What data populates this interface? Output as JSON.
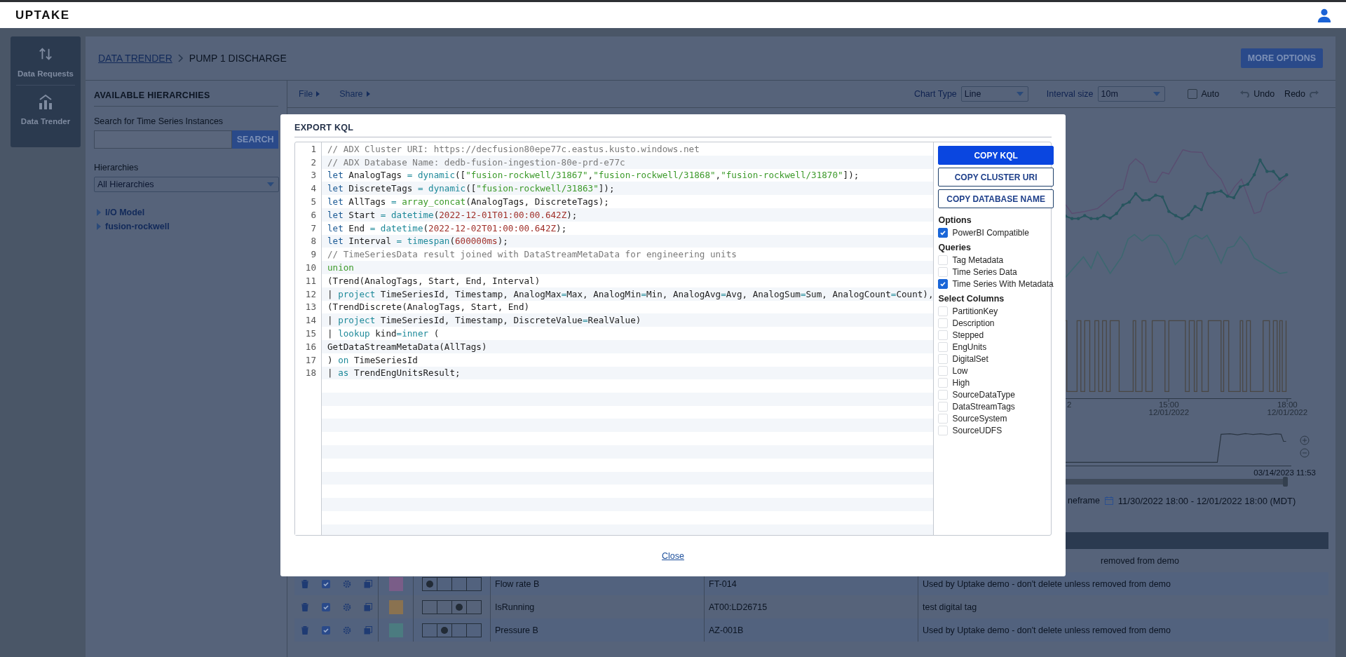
{
  "header": {
    "logo": "UPTAKE"
  },
  "nav": [
    {
      "label": "Data Requests",
      "kind": "requests"
    },
    {
      "label": "Data Trender",
      "kind": "trender"
    }
  ],
  "breadcrumb": {
    "link": "DATA TRENDER",
    "current": "PUMP 1 DISCHARGE"
  },
  "more_options": "MORE OPTIONS",
  "hierarchies_panel": {
    "title": "AVAILABLE HIERARCHIES",
    "search_label": "Search for Time Series Instances",
    "search_button": "SEARCH",
    "hierarchies_label": "Hierarchies",
    "hierarchies_value": "All Hierarchies",
    "tree": [
      {
        "label": "I/O Model",
        "expanded": false
      },
      {
        "label": "fusion-rockwell",
        "expanded": false
      }
    ]
  },
  "toolbar": {
    "menus": [
      "File",
      "Share"
    ],
    "chart_type_label": "Chart Type",
    "chart_type": "Line",
    "interval_label": "Interval size",
    "interval": "10m",
    "auto": {
      "label": "Auto",
      "checked": false
    },
    "undo": "Undo",
    "redo": "Redo"
  },
  "chart": {
    "x_labels": [
      {
        "lines": [
          "2"
        ]
      },
      {
        "lines": [
          "15:00",
          "12/01/2022"
        ]
      },
      {
        "lines": [
          "18:00",
          "12/01/2022"
        ]
      }
    ]
  },
  "overview": {
    "end_label": "03/14/2023 11:53",
    "timeframe_label": "neframe",
    "timeframe": "11/30/2022 18:00 - 12/01/2022 18:00 (MDT)"
  },
  "table": {
    "rows": [
      {
        "description": "removed from demo"
      },
      {
        "visible": true,
        "color": "#7a5d88",
        "positions": [
          {
            "selected": true
          },
          {
            "selected": false
          },
          {
            "selected": false
          },
          {
            "selected": false
          }
        ],
        "name": "Flow rate B",
        "tag": "FT-014",
        "description": "Used by Uptake demo - don't delete unless removed from demo"
      },
      {
        "visible": true,
        "color": "#8a7250",
        "positions": [
          {
            "selected": false
          },
          {
            "selected": false
          },
          {
            "selected": true
          },
          {
            "selected": false
          }
        ],
        "name": "IsRunning",
        "tag": "AT00:LD26715",
        "description": "test digital tag"
      },
      {
        "visible": true,
        "color": "#4b7b80",
        "positions": [
          {
            "selected": false
          },
          {
            "selected": true
          },
          {
            "selected": false
          },
          {
            "selected": false
          }
        ],
        "name": "Pressure B",
        "tag": "AZ-001B",
        "description": "Used by Uptake demo - don't delete unless removed from demo"
      }
    ]
  },
  "modal": {
    "title": "EXPORT KQL",
    "code": [
      {
        "number": "1",
        "tokens": [
          {
            "kind": "comment",
            "text": "// ADX Cluster URI: https://decfusion80epe77c.eastus.kusto.windows.net"
          }
        ]
      },
      {
        "number": "2",
        "tokens": [
          {
            "kind": "comment",
            "text": "// ADX Database Name: dedb-fusion-ingestion-80e-prd-e77c"
          }
        ]
      },
      {
        "number": "3",
        "tokens": [
          {
            "kind": "keyword",
            "text": "let"
          },
          {
            "kind": "plain",
            "text": " AnalogTags "
          },
          {
            "kind": "function",
            "text": "="
          },
          {
            "kind": "function",
            "text": " dynamic"
          },
          {
            "kind": "plain",
            "text": "(["
          },
          {
            "kind": "string",
            "text": "\"fusion-rockwell/31867\""
          },
          {
            "kind": "plain",
            "text": ","
          },
          {
            "kind": "string",
            "text": "\"fusion-rockwell/31868\""
          },
          {
            "kind": "plain",
            "text": ","
          },
          {
            "kind": "string",
            "text": "\"fusion-rockwell/31870\""
          },
          {
            "kind": "plain",
            "text": "]);"
          }
        ]
      },
      {
        "number": "4",
        "tokens": [
          {
            "kind": "keyword",
            "text": "let"
          },
          {
            "kind": "plain",
            "text": " DiscreteTags "
          },
          {
            "kind": "function",
            "text": "="
          },
          {
            "kind": "function",
            "text": " dynamic"
          },
          {
            "kind": "plain",
            "text": "(["
          },
          {
            "kind": "string",
            "text": "\"fusion-rockwell/31863\""
          },
          {
            "kind": "plain",
            "text": "]);"
          }
        ]
      },
      {
        "number": "5",
        "tokens": [
          {
            "kind": "keyword",
            "text": "let"
          },
          {
            "kind": "plain",
            "text": " AllTags "
          },
          {
            "kind": "function",
            "text": "="
          },
          {
            "kind": "builtin",
            "text": " array_concat"
          },
          {
            "kind": "plain",
            "text": "(AnalogTags, DiscreteTags);"
          }
        ]
      },
      {
        "number": "6",
        "tokens": [
          {
            "kind": "keyword",
            "text": "let"
          },
          {
            "kind": "plain",
            "text": " Start "
          },
          {
            "kind": "function",
            "text": "="
          },
          {
            "kind": "function",
            "text": " datetime"
          },
          {
            "kind": "plain",
            "text": "("
          },
          {
            "kind": "literal",
            "text": "2022-12-01T01:00:00.642Z"
          },
          {
            "kind": "plain",
            "text": ");"
          }
        ]
      },
      {
        "number": "7",
        "tokens": [
          {
            "kind": "keyword",
            "text": "let"
          },
          {
            "kind": "plain",
            "text": " End "
          },
          {
            "kind": "function",
            "text": "="
          },
          {
            "kind": "function",
            "text": " datetime"
          },
          {
            "kind": "plain",
            "text": "("
          },
          {
            "kind": "literal",
            "text": "2022-12-02T01:00:00.642Z"
          },
          {
            "kind": "plain",
            "text": ");"
          }
        ]
      },
      {
        "number": "8",
        "tokens": [
          {
            "kind": "keyword",
            "text": "let"
          },
          {
            "kind": "plain",
            "text": " Interval "
          },
          {
            "kind": "function",
            "text": "="
          },
          {
            "kind": "function",
            "text": " timespan"
          },
          {
            "kind": "plain",
            "text": "("
          },
          {
            "kind": "literal",
            "text": "600000ms"
          },
          {
            "kind": "plain",
            "text": ");"
          }
        ]
      },
      {
        "number": "9",
        "tokens": [
          {
            "kind": "comment",
            "text": "// TimeSeriesData result joined with DataStreamMetaData for engineering units"
          }
        ]
      },
      {
        "number": "10",
        "tokens": [
          {
            "kind": "builtin",
            "text": "union"
          }
        ]
      },
      {
        "number": "11",
        "tokens": [
          {
            "kind": "plain",
            "text": "(Trend(AnalogTags, Start, End, Interval)"
          }
        ]
      },
      {
        "number": "12",
        "tokens": [
          {
            "kind": "plain",
            "text": "| "
          },
          {
            "kind": "function",
            "text": "project"
          },
          {
            "kind": "plain",
            "text": " TimeSeriesId, Timestamp, AnalogMax"
          },
          {
            "kind": "function",
            "text": "="
          },
          {
            "kind": "plain",
            "text": "Max, AnalogMin"
          },
          {
            "kind": "function",
            "text": "="
          },
          {
            "kind": "plain",
            "text": "Min, AnalogAvg"
          },
          {
            "kind": "function",
            "text": "="
          },
          {
            "kind": "plain",
            "text": "Avg, AnalogSum"
          },
          {
            "kind": "function",
            "text": "="
          },
          {
            "kind": "plain",
            "text": "Sum, AnalogCount"
          },
          {
            "kind": "function",
            "text": "="
          },
          {
            "kind": "plain",
            "text": "Count),"
          }
        ]
      },
      {
        "number": "13",
        "tokens": [
          {
            "kind": "plain",
            "text": "(TrendDiscrete(AnalogTags, Start, End)"
          }
        ]
      },
      {
        "number": "14",
        "tokens": [
          {
            "kind": "plain",
            "text": "| "
          },
          {
            "kind": "function",
            "text": "project"
          },
          {
            "kind": "plain",
            "text": " TimeSeriesId, Timestamp, DiscreteValue"
          },
          {
            "kind": "function",
            "text": "="
          },
          {
            "kind": "plain",
            "text": "RealValue)"
          }
        ]
      },
      {
        "number": "15",
        "tokens": [
          {
            "kind": "plain",
            "text": "| "
          },
          {
            "kind": "function",
            "text": "lookup"
          },
          {
            "kind": "plain",
            "text": " kind"
          },
          {
            "kind": "function",
            "text": "=inner"
          },
          {
            "kind": "plain",
            "text": " ("
          }
        ]
      },
      {
        "number": "16",
        "tokens": [
          {
            "kind": "plain",
            "text": "GetDataStreamMetaData(AllTags)"
          }
        ]
      },
      {
        "number": "17",
        "tokens": [
          {
            "kind": "plain",
            "text": ") "
          },
          {
            "kind": "function",
            "text": "on"
          },
          {
            "kind": "plain",
            "text": " TimeSeriesId"
          }
        ]
      },
      {
        "number": "18",
        "tokens": [
          {
            "kind": "plain",
            "text": "| "
          },
          {
            "kind": "function",
            "text": "as"
          },
          {
            "kind": "plain",
            "text": " TrendEngUnitsResult;"
          }
        ]
      }
    ],
    "buttons": [
      {
        "label": "COPY KQL",
        "primary": true
      },
      {
        "label": "COPY CLUSTER URI",
        "primary": false
      },
      {
        "label": "COPY DATABASE NAME",
        "primary": false
      }
    ],
    "groups": [
      {
        "title": "Options",
        "items": [
          {
            "label": "PowerBI Compatible",
            "checked": true
          }
        ]
      },
      {
        "title": "Queries",
        "items": [
          {
            "label": "Tag Metadata",
            "checked": false
          },
          {
            "label": "Time Series Data",
            "checked": false
          },
          {
            "label": "Time Series With Metadata",
            "checked": true
          }
        ]
      },
      {
        "title": "Select Columns",
        "items": [
          {
            "label": "PartitionKey",
            "checked": false
          },
          {
            "label": "Description",
            "checked": false
          },
          {
            "label": "Stepped",
            "checked": false
          },
          {
            "label": "EngUnits",
            "checked": false
          },
          {
            "label": "DigitalSet",
            "checked": false
          },
          {
            "label": "Low",
            "checked": false
          },
          {
            "label": "High",
            "checked": false
          },
          {
            "label": "SourceDataType",
            "checked": false
          },
          {
            "label": "DataStreamTags",
            "checked": false
          },
          {
            "label": "SourceSystem",
            "checked": false
          },
          {
            "label": "SourceUDFS",
            "checked": false
          }
        ]
      }
    ],
    "close": "Close"
  }
}
